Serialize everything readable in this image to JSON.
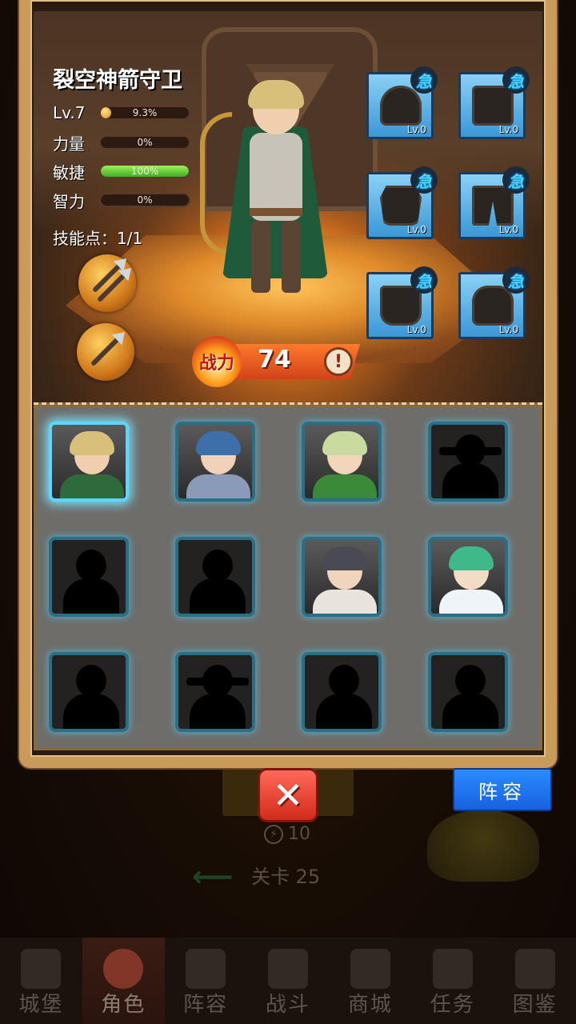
{
  "hero": {
    "name": "裂空神箭守卫",
    "level_label": "Lv.7",
    "exp_percent_text": "9.3%",
    "exp_percent": 9.3,
    "stats": [
      {
        "label": "力量",
        "value_text": "0%",
        "value": 0
      },
      {
        "label": "敏捷",
        "value_text": "100%",
        "value": 100
      },
      {
        "label": "智力",
        "value_text": "0%",
        "value": 0
      }
    ],
    "skill_points": "技能点：1/1"
  },
  "equipment": [
    {
      "icon": "helmet-icon",
      "level": "Lv.0",
      "badge": "急"
    },
    {
      "icon": "gauntlets-icon",
      "level": "Lv.0",
      "badge": "急"
    },
    {
      "icon": "armor-icon",
      "level": "Lv.0",
      "badge": "急"
    },
    {
      "icon": "pants-icon",
      "level": "Lv.0",
      "badge": "急"
    },
    {
      "icon": "boots-icon",
      "level": "Lv.0",
      "badge": "急"
    },
    {
      "icon": "gloves-icon",
      "level": "Lv.0",
      "badge": "急"
    }
  ],
  "power": {
    "label": "战力",
    "value": "74",
    "info_icon": "!"
  },
  "roster": [
    {
      "state": "unlocked",
      "selected": true,
      "hair": "#d9c07a",
      "skin": "#f1cfae",
      "outfit": "#2f6b3a"
    },
    {
      "state": "unlocked",
      "selected": false,
      "hair": "#3f6fa8",
      "skin": "#f1d2b8",
      "outfit": "#8a9ab8"
    },
    {
      "state": "unlocked",
      "selected": false,
      "hair": "#c8dca0",
      "skin": "#f1d6bb",
      "outfit": "#3a8a3a"
    },
    {
      "state": "locked"
    },
    {
      "state": "locked"
    },
    {
      "state": "locked"
    },
    {
      "state": "unlocked",
      "selected": false,
      "hair": "#4a4a55",
      "skin": "#f0d4bb",
      "outfit": "#e8e4dc"
    },
    {
      "state": "unlocked",
      "selected": false,
      "hair": "#3fb88a",
      "skin": "#f3dcc6",
      "outfit": "#eef4f8"
    },
    {
      "state": "locked"
    },
    {
      "state": "locked"
    },
    {
      "state": "locked"
    },
    {
      "state": "locked"
    }
  ],
  "buttons": {
    "close": "✕",
    "lineup": "阵容"
  },
  "background": {
    "energy": "10",
    "stage": "关卡 25"
  },
  "nav": [
    {
      "label": "城堡",
      "icon": "castle-icon",
      "active": false
    },
    {
      "label": "角色",
      "icon": "character-icon",
      "active": true
    },
    {
      "label": "阵容",
      "icon": "lineup-icon",
      "active": false
    },
    {
      "label": "战斗",
      "icon": "battle-icon",
      "active": false
    },
    {
      "label": "商城",
      "icon": "shop-icon",
      "active": false
    },
    {
      "label": "任务",
      "icon": "quest-icon",
      "active": false
    },
    {
      "label": "图鉴",
      "icon": "codex-icon",
      "active": false
    }
  ]
}
